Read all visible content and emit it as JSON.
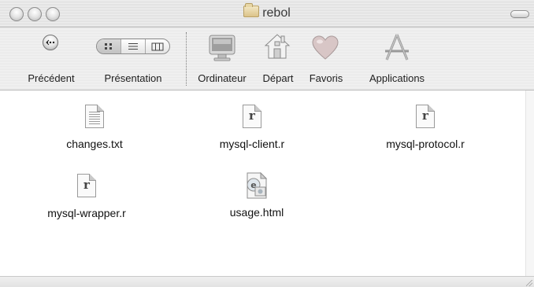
{
  "window": {
    "title": "rebol",
    "title_icon": "folder-icon"
  },
  "toolbar": {
    "back": {
      "label": "Précédent",
      "icon": "back-arrow-icon",
      "glyph": "⬅"
    },
    "view": {
      "label": "Présentation",
      "modes": [
        {
          "name": "icon-view",
          "glyph": "▦"
        },
        {
          "name": "list-view",
          "glyph": "≡"
        },
        {
          "name": "column-view",
          "glyph": "▥"
        }
      ],
      "selected": "icon-view"
    },
    "shortcuts": [
      {
        "label": "Ordinateur",
        "icon": "computer-icon"
      },
      {
        "label": "Départ",
        "icon": "home-icon"
      },
      {
        "label": "Favoris",
        "icon": "heart-icon"
      },
      {
        "label": "Applications",
        "icon": "applications-icon"
      }
    ]
  },
  "files": [
    {
      "name": "changes.txt",
      "icon": "text-document-icon"
    },
    {
      "name": "mysql-client.r",
      "icon": "rebol-script-icon"
    },
    {
      "name": "mysql-protocol.r",
      "icon": "rebol-script-icon"
    },
    {
      "name": "mysql-wrapper.r",
      "icon": "rebol-script-icon"
    },
    {
      "name": "usage.html",
      "icon": "html-document-icon"
    }
  ],
  "colors": {
    "titlebar": "#dcdcdc",
    "toolbar": "#e7e7e7",
    "content_bg": "#ffffff",
    "heart": "#d9c2c2"
  }
}
